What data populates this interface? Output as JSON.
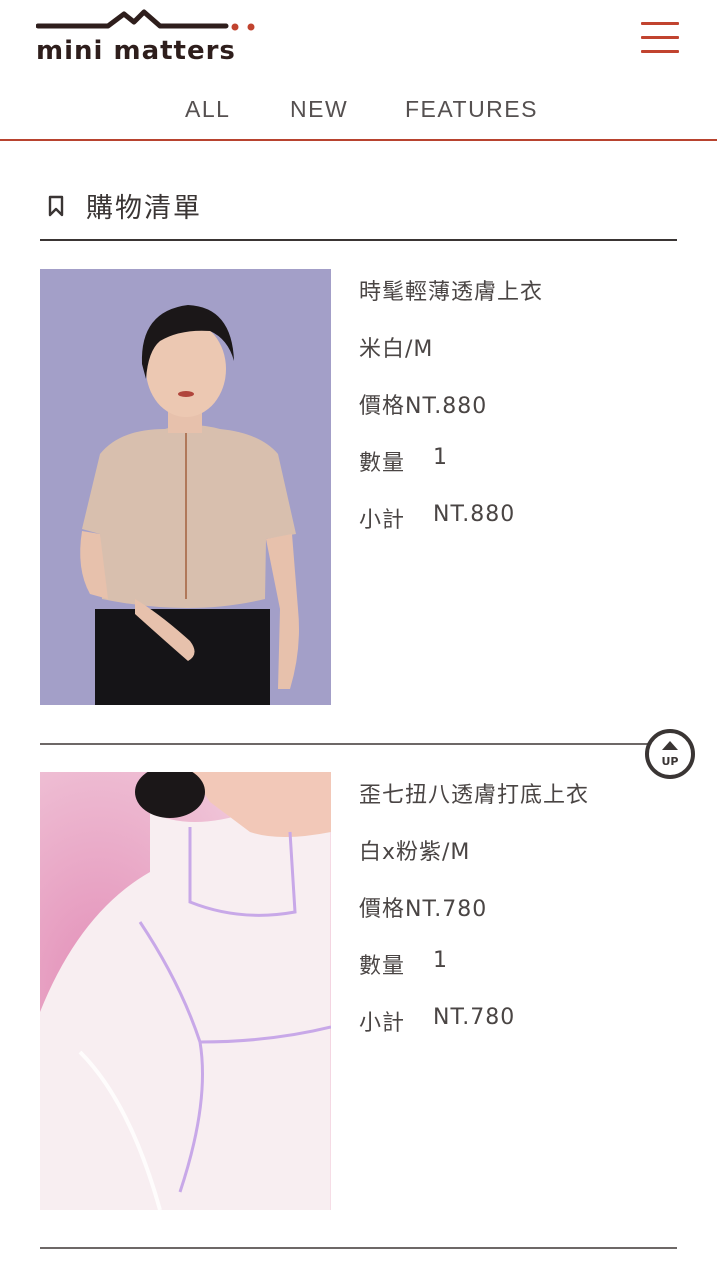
{
  "brand": {
    "name": "mini matters"
  },
  "header": {
    "menu_icon": "hamburger-menu-icon",
    "accent_color": "#c1432f"
  },
  "nav": {
    "items": [
      {
        "label": "ALL"
      },
      {
        "label": "NEW"
      },
      {
        "label": "FEATURES"
      }
    ]
  },
  "cart": {
    "title": "購物清單",
    "title_icon": "bookmark-icon",
    "items": [
      {
        "name": "時髦輕薄透膚上衣",
        "variant": "米白/M",
        "price": "價格NT.880",
        "qty_label": "數量",
        "qty": "1",
        "subtotal_label": "小計",
        "subtotal": "NT.880",
        "image": "model-in-beige-sheer-top-photo"
      },
      {
        "name": "歪七扭八透膚打底上衣",
        "variant": "白x粉紫/M",
        "price": "價格NT.780",
        "qty_label": "數量",
        "qty": "1",
        "subtotal_label": "小計",
        "subtotal": "NT.780",
        "image": "white-sheer-turtleneck-on-pink-photo"
      }
    ]
  },
  "scroll_top": {
    "label": "UP",
    "icon": "arrow-up-icon"
  }
}
